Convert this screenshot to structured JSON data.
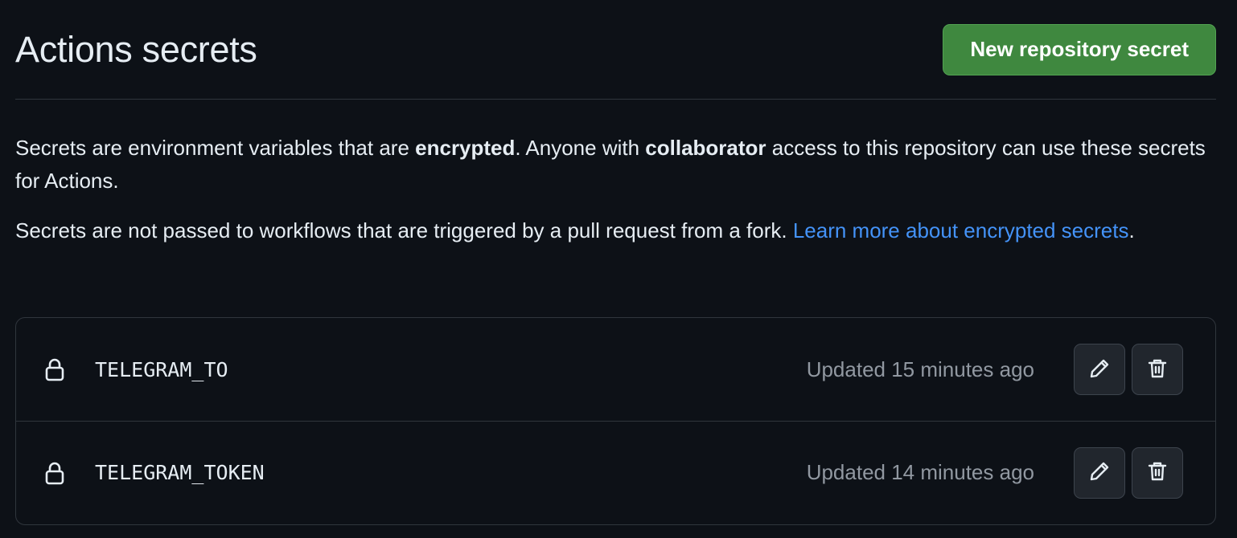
{
  "header": {
    "title": "Actions secrets",
    "new_secret_button": "New repository secret"
  },
  "description": {
    "p1_a": "Secrets are environment variables that are ",
    "p1_b": "encrypted",
    "p1_c": ". Anyone with ",
    "p1_d": "collaborator",
    "p1_e": " access to this repository can use these secrets for Actions.",
    "p2_a": "Secrets are not passed to workflows that are triggered by a pull request from a fork. ",
    "p2_link": "Learn more about encrypted secrets",
    "p2_end": "."
  },
  "secrets": [
    {
      "name": "TELEGRAM_TO",
      "updated": "Updated 15 minutes ago",
      "icon": "lock-icon"
    },
    {
      "name": "TELEGRAM_TOKEN",
      "updated": "Updated 14 minutes ago",
      "icon": "lock-icon"
    }
  ],
  "actions": {
    "edit_icon": "pencil-icon",
    "delete_icon": "trash-icon"
  },
  "colors": {
    "background": "#0d1117",
    "primary_button": "#3f883f",
    "link": "#4493f8",
    "border": "#30363d",
    "muted_text": "#9198a1"
  }
}
